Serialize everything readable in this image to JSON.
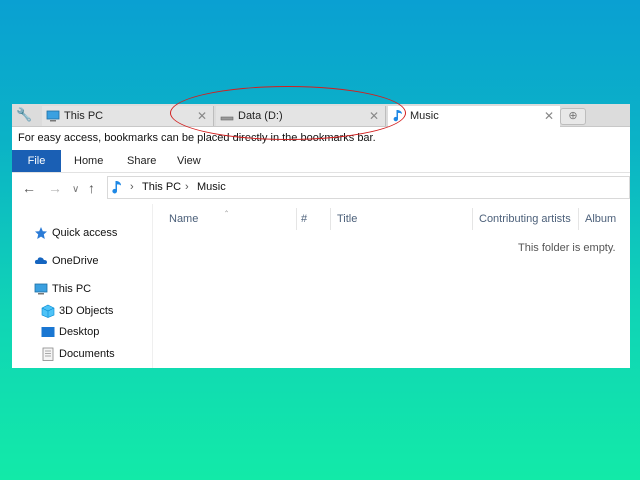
{
  "tabs": [
    {
      "label": "This PC",
      "icon": "computer-icon"
    },
    {
      "label": "Data (D:)",
      "icon": "drive-icon"
    },
    {
      "label": "Music",
      "icon": "music-note-icon"
    }
  ],
  "bookmarks_hint": "For easy access, bookmarks can be placed directly in the bookmarks bar.",
  "ribbon": {
    "file": "File",
    "home": "Home",
    "share": "Share",
    "view": "View"
  },
  "address": {
    "crumbs": [
      "This PC",
      "Music"
    ]
  },
  "nav_items": [
    {
      "label": "Quick access",
      "icon": "star-icon"
    },
    {
      "label": "OneDrive",
      "icon": "cloud-icon"
    },
    {
      "label": "This PC",
      "icon": "computer-icon"
    },
    {
      "label": "3D Objects",
      "icon": "cube-icon"
    },
    {
      "label": "Desktop",
      "icon": "desktop-icon"
    },
    {
      "label": "Documents",
      "icon": "document-icon"
    }
  ],
  "columns": {
    "name": "Name",
    "num": "#",
    "title": "Title",
    "artists": "Contributing artists",
    "album": "Album"
  },
  "empty_text": "This folder is empty.",
  "colors": {
    "accent": "#1a5fb4",
    "annotation": "#d21f1f"
  }
}
